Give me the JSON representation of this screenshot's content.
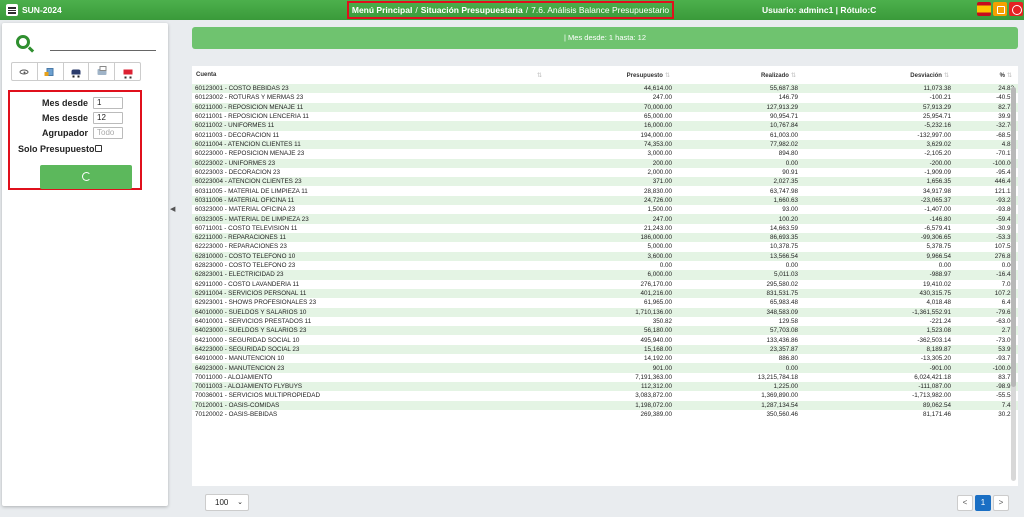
{
  "app": {
    "name": "SUN-2024"
  },
  "breadcrumb": {
    "items": [
      "Menú Principal",
      "Situación Presupuestaria"
    ],
    "current": "7.6. Análisis Balance Presupuestario"
  },
  "user": {
    "label": "Usuario: adminc1 | Rótulo:C"
  },
  "filters": {
    "mes_desde_label": "Mes desde",
    "mes_desde_value": "1",
    "mes_hasta_label": "Mes desde",
    "mes_hasta_value": "12",
    "agrupador_label": "Agrupador",
    "agrupador_placeholder": "Todo",
    "solo_presupuesto_label": "Solo Presupuesto"
  },
  "banner": {
    "text": "| Mes desde: 1 hasta: 12"
  },
  "table": {
    "columns": [
      "Cuenta",
      "Presupuesto",
      "Realizado",
      "Desviación",
      "%"
    ],
    "rows": [
      [
        "60123001 - COSTO BEBIDAS 23",
        "44,614.00",
        "55,687.38",
        "11,073.38",
        "24.82"
      ],
      [
        "60123002 - ROTURAS Y MERMAS 23",
        "247.00",
        "146.79",
        "-100.21",
        "-40.57"
      ],
      [
        "60211000 - REPOSICION MENAJE 11",
        "70,000.00",
        "127,913.29",
        "57,913.29",
        "82.73"
      ],
      [
        "60211001 - REPOSICION LENCERIA 11",
        "65,000.00",
        "90,954.71",
        "25,954.71",
        "39.93"
      ],
      [
        "60211002 - UNIFORMES 11",
        "16,000.00",
        "10,767.84",
        "-5,232.16",
        "-32.70"
      ],
      [
        "60211003 - DECORACION 11",
        "194,000.00",
        "61,003.00",
        "-132,997.00",
        "-68.56"
      ],
      [
        "60211004 - ATENCION CLIENTES 11",
        "74,353.00",
        "77,982.02",
        "3,629.02",
        "4.88"
      ],
      [
        "60223000 - REPOSICION MENAJE 23",
        "3,000.00",
        "894.80",
        "-2,105.20",
        "-70.17"
      ],
      [
        "60223002 - UNIFORMES 23",
        "200.00",
        "0.00",
        "-200.00",
        "-100.00"
      ],
      [
        "60223003 - DECORACION 23",
        "2,000.00",
        "90.91",
        "-1,909.09",
        "-95.45"
      ],
      [
        "60223004 - ATENCION CLIENTES 23",
        "371.00",
        "2,027.35",
        "1,656.35",
        "446.46"
      ],
      [
        "60311005 - MATERIAL DE LIMPIEZA 11",
        "28,830.00",
        "63,747.98",
        "34,917.98",
        "121.12"
      ],
      [
        "60311006 - MATERIAL OFICINA 11",
        "24,726.00",
        "1,660.63",
        "-23,065.37",
        "-93.28"
      ],
      [
        "60323000 - MATERIAL OFICINA 23",
        "1,500.00",
        "93.00",
        "-1,407.00",
        "-93.80"
      ],
      [
        "60323005 - MATERIAL DE LIMPIEZA 23",
        "247.00",
        "100.20",
        "-146.80",
        "-59.43"
      ],
      [
        "60711001 - COSTO TELEVISION 11",
        "21,243.00",
        "14,663.59",
        "-6,579.41",
        "-30.97"
      ],
      [
        "62211000 - REPARACIONES 11",
        "186,000.00",
        "86,693.35",
        "-99,306.65",
        "-53.39"
      ],
      [
        "62223000 - REPARACIONES 23",
        "5,000.00",
        "10,378.75",
        "5,378.75",
        "107.58"
      ],
      [
        "62810000 - COSTO TELEFONO 10",
        "3,600.00",
        "13,566.54",
        "9,966.54",
        "276.85"
      ],
      [
        "62823000 - COSTO TELEFONO 23",
        "0.00",
        "0.00",
        "0.00",
        "0.00"
      ],
      [
        "62823001 - ELECTRICIDAD 23",
        "6,000.00",
        "5,011.03",
        "-988.97",
        "-16.48"
      ],
      [
        "62911000 - COSTO LAVANDERIA 11",
        "276,170.00",
        "295,580.02",
        "19,410.02",
        "7.03"
      ],
      [
        "62911004 - SERVICIOS PERSONAL 11",
        "401,216.00",
        "831,531.75",
        "430,315.75",
        "107.25"
      ],
      [
        "62923001 - SHOWS PROFESIONALES 23",
        "61,965.00",
        "65,983.48",
        "4,018.48",
        "6.49"
      ],
      [
        "64010000 - SUELDOS Y SALARIOS 10",
        "1,710,136.00",
        "348,583.09",
        "-1,361,552.91",
        "-79.62"
      ],
      [
        "64010001 - SERVICIOS PRESTADOS 11",
        "350.82",
        "129.58",
        "-221.24",
        "-63.06"
      ],
      [
        "64023000 - SUELDOS Y SALARIOS 23",
        "56,180.00",
        "57,703.08",
        "1,523.08",
        "2.71"
      ],
      [
        "64210000 - SEGURIDAD SOCIAL 10",
        "495,940.00",
        "133,436.86",
        "-362,503.14",
        "-73.09"
      ],
      [
        "64223000 - SEGURIDAD SOCIAL 23",
        "15,168.00",
        "23,357.87",
        "8,189.87",
        "53.99"
      ],
      [
        "64910000 - MANUTENCION 10",
        "14,192.00",
        "886.80",
        "-13,305.20",
        "-93.75"
      ],
      [
        "64923000 - MANUTENCION 23",
        "901.00",
        "0.00",
        "-901.00",
        "-100.00"
      ],
      [
        "70011000 - ALOJAMIENTO",
        "7,191,363.00",
        "13,215,784.18",
        "6,024,421.18",
        "83.77"
      ],
      [
        "70011003 - ALOJAMIENTO FLYBUYS",
        "112,312.00",
        "1,225.00",
        "-111,087.00",
        "-98.91"
      ],
      [
        "70036001 - SERVICIOS MULTIPROPIEDAD",
        "3,083,872.00",
        "1,369,890.00",
        "-1,713,982.00",
        "-55.58"
      ],
      [
        "70120001 - OASIS-COMIDAS",
        "1,198,072.00",
        "1,287,134.54",
        "89,062.54",
        "7.43"
      ],
      [
        "70120002 - OASIS-BEBIDAS",
        "269,389.00",
        "350,560.46",
        "81,171.46",
        "30.23"
      ]
    ]
  },
  "pagination": {
    "page_size": "100",
    "current_page": "1",
    "prev": "<",
    "next": ">"
  }
}
